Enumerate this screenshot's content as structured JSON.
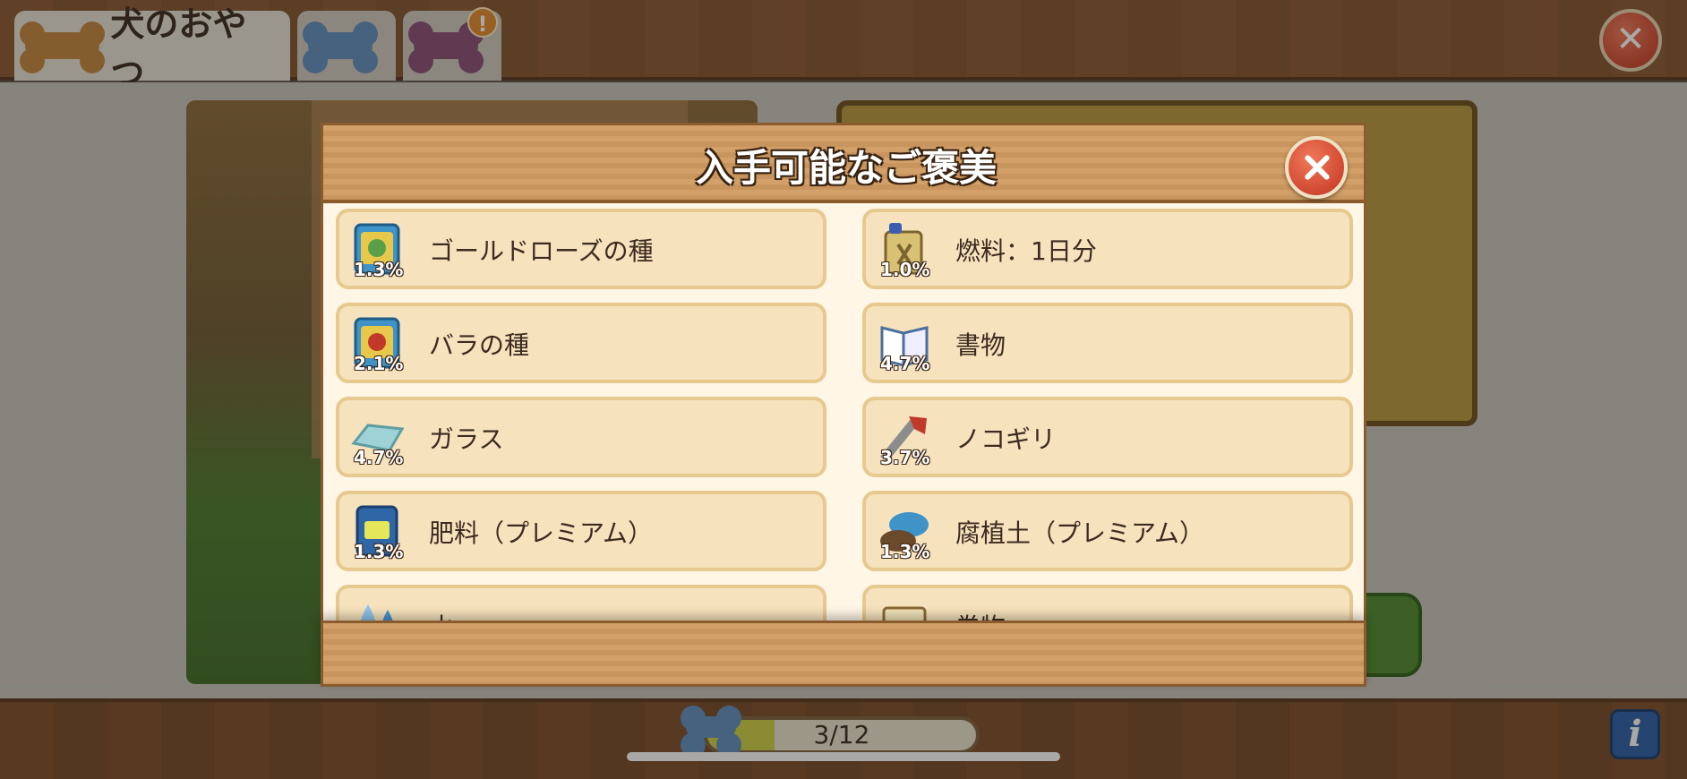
{
  "header": {
    "tab_title": "犬のおやつ",
    "tabs": [
      {
        "label": "犬のおやつ",
        "icon": "bone-icon",
        "selected": true
      },
      {
        "label": "",
        "icon": "blue-bone-icon",
        "selected": false
      },
      {
        "label": "",
        "icon": "purple-bone-icon",
        "selected": false,
        "badge": "!"
      }
    ]
  },
  "progress": {
    "text": "3/12",
    "value": 0.25
  },
  "modal": {
    "title": "入手可能なご褒美",
    "rewards": [
      {
        "name": "ゴールドローズの種",
        "percent": "1.3%",
        "icon": "gold-rose-seed-packet-icon"
      },
      {
        "name": "燃料：1日分",
        "percent": "1.0%",
        "icon": "fuel-can-icon"
      },
      {
        "name": "バラの種",
        "percent": "2.1%",
        "icon": "rose-seed-packet-icon"
      },
      {
        "name": "書物",
        "percent": "4.7%",
        "icon": "book-icon"
      },
      {
        "name": "ガラス",
        "percent": "4.7%",
        "icon": "glass-pane-icon"
      },
      {
        "name": "ノコギリ",
        "percent": "3.7%",
        "icon": "saw-icon"
      },
      {
        "name": "肥料（プレミアム）",
        "percent": "1.3%",
        "icon": "fertilizer-bag-icon"
      },
      {
        "name": "腐植土（プレミアム）",
        "percent": "1.3%",
        "icon": "humus-soil-icon"
      },
      {
        "name": "水",
        "percent": "",
        "icon": "water-drops-icon"
      },
      {
        "name": "巻物",
        "percent": "",
        "icon": "scroll-icon"
      }
    ]
  },
  "colors": {
    "wood": "#c8955e",
    "cream": "#fff6e6",
    "item_bg": "#f6e2bc",
    "close_red": "#c23220"
  }
}
